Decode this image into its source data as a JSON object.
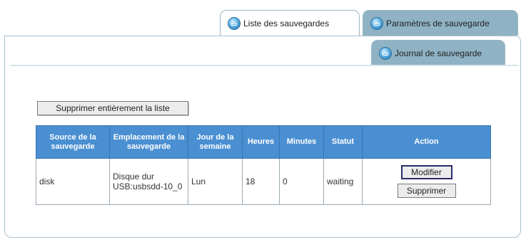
{
  "tabs": {
    "list": "Liste des sauvegardes",
    "params": "Paramètres de sauvegarde",
    "journal": "Journal de sauvegarde"
  },
  "clear_button": "Supprimer entièrement la liste",
  "table": {
    "headers": {
      "source": "Source de la sauvegarde",
      "location": "Emplacement de la sauvegarde",
      "day": "Jour de la semaine",
      "hours": "Heures",
      "minutes": "Minutes",
      "status": "Statut",
      "action": "Action"
    },
    "rows": [
      {
        "source": "disk",
        "location": "Disque dur USB:usbsdd-10_0",
        "day": "Lun",
        "hours": "18",
        "minutes": "0",
        "status": "waiting",
        "modify": "Modifier",
        "delete": "Supprimer"
      }
    ]
  },
  "colors": {
    "header_bg": "#4a8fd1",
    "tab_inactive": "#8fb3c4",
    "tab_border": "#9fb6c4"
  }
}
